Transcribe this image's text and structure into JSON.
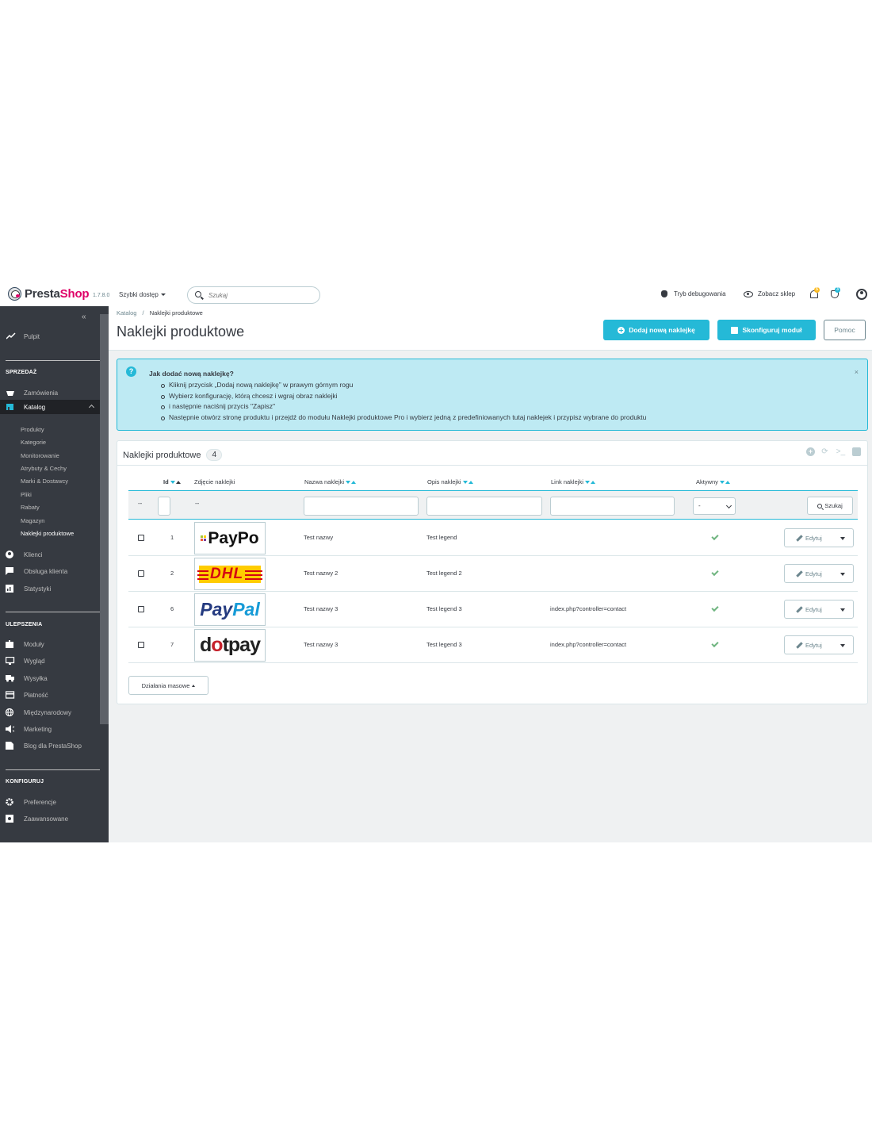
{
  "header": {
    "logo_text_a": "Presta",
    "logo_text_b": "Shop",
    "version": "1.7.8.0",
    "quick_access": "Szybki dostęp",
    "search_placeholder": "Szukaj",
    "debug_mode": "Tryb debugowania",
    "view_shop": "Zobacz sklep",
    "notif_badge_1": "5",
    "notif_badge_2": "3"
  },
  "sidebar": {
    "dashboard": "Pulpit",
    "sections": {
      "sell": "SPRZEDAŻ",
      "improve": "ULEPSZENIA",
      "configure": "KONFIGURUJ"
    },
    "sell_items": [
      "Zamówienia",
      "Katalog"
    ],
    "catalog_sub": [
      "Produkty",
      "Kategorie",
      "Monitorowanie",
      "Atrybuty & Cechy",
      "Marki & Dostawcy",
      "Pliki",
      "Rabaty",
      "Magazyn",
      "Naklejki produktowe"
    ],
    "sell_items_2": [
      "Klienci",
      "Obsługa klienta",
      "Statystyki"
    ],
    "improve_items": [
      "Moduły",
      "Wygląd",
      "Wysyłka",
      "Płatność",
      "Międzynarodowy",
      "Marketing",
      "Blog dla PrestaShop"
    ],
    "configure_items": [
      "Preferencje",
      "Zaawansowane"
    ]
  },
  "page": {
    "breadcrumb_parent": "Katalog",
    "breadcrumb_sep": "/",
    "breadcrumb_current": "Naklejki produktowe",
    "title": "Naklejki produktowe",
    "btn_add": "Dodaj nową naklejkę",
    "btn_configure": "Skonfiguruj moduł",
    "btn_help": "Pomoc"
  },
  "alert": {
    "icon": "?",
    "title": "Jak dodać nową naklejkę?",
    "close": "×",
    "items": [
      "Kliknij przycisk „Dodaj nową naklejkę” w prawym górnym rogu",
      "Wybierz konfigurację, którą chcesz i wgraj obraz naklejki",
      "i następnie naciśnij przycis \"Zapisz\"",
      "Następnie otwórz stronę produktu i przejdź do modułu Naklejki produktowe Pro i wybierz jedną z predefiniowanych tutaj naklejek i przypisz wybrane do produktu"
    ]
  },
  "table": {
    "title": "Naklejki produktowe",
    "count": "4",
    "columns": [
      "Id",
      "Zdjęcie naklejki",
      "Nazwa naklejki",
      "Opis naklejki",
      "Link naklejki",
      "Aktywny"
    ],
    "filter_dash_1": "--",
    "filter_dash_2": "--",
    "filter_select": "-",
    "search_btn": "Szukaj",
    "edit_label": "Edytuj",
    "bulk_label": "Działania masowe",
    "rows": [
      {
        "id": "1",
        "logo": "PayPo",
        "name": "Test nazwy",
        "desc": "Test legend",
        "link": ""
      },
      {
        "id": "2",
        "logo": "DHL",
        "name": "Test nazwy 2",
        "desc": "Test legend 2",
        "link": ""
      },
      {
        "id": "6",
        "logo": "PayPal",
        "name": "Test nazwy 3",
        "desc": "Test legend 3",
        "link": "index.php?controller=contact"
      },
      {
        "id": "7",
        "logo": "dotpay",
        "name": "Test nazwy 3",
        "desc": "Test legend 3",
        "link": "index.php?controller=contact"
      }
    ],
    "logo_parts": {
      "paypal_a": "Pay",
      "paypal_b": "Pal",
      "dotpay_a": "d",
      "dotpay_b": "o",
      "dotpay_c": "tpay"
    }
  },
  "colors": {
    "primary": "#25b9d7",
    "brand_pink": "#df0067",
    "sidebar_bg": "#363a41",
    "success": "#70b580",
    "alert_bg": "#beeaf3"
  }
}
